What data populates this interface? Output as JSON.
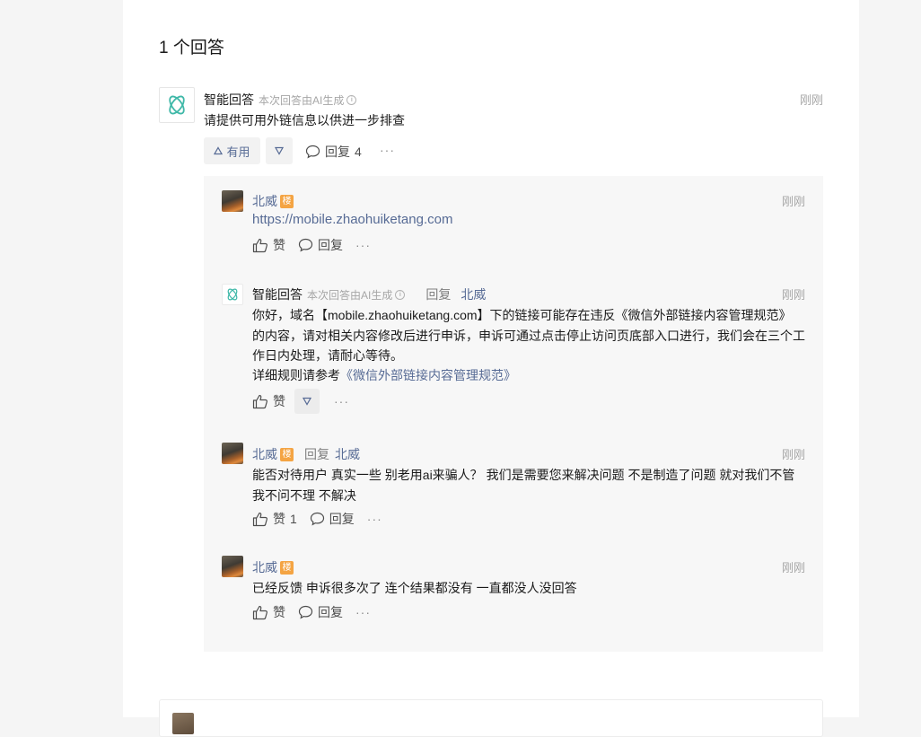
{
  "answers": {
    "count_title": "1 个回答"
  },
  "answer": {
    "author": "智能回答",
    "ai_notice": "本次回答由AI生成",
    "time": "刚刚",
    "text": "请提供可用外链信息以供进一步排查",
    "useful_label": "有用",
    "reply_label": "回复",
    "reply_count": "4",
    "more": "···"
  },
  "replies": [
    {
      "author": "北威",
      "badge": "楼",
      "time": "刚刚",
      "text": "https://mobile.zhaohuiketang.com",
      "like_label": "赞",
      "reply_label": "回复",
      "more": "···"
    },
    {
      "author": "智能回答",
      "ai_notice": "本次回答由AI生成",
      "reply_word": "回复",
      "reply_to": "北威",
      "time": "刚刚",
      "lines": [
        "你好，域名【mobile.zhaohuiketang.com】下的链接可能存在违反《微信外部链接内容管理规范》",
        "的内容，请对相关内容修改后进行申诉，申诉可通过点击停止访问页底部入口进行，我们会在三个工",
        "作日内处理，请耐心等待。"
      ],
      "detail_prefix": "详细规则请参考",
      "detail_link": "《微信外部链接内容管理规范》",
      "like_label": "赞",
      "more": "···"
    },
    {
      "author": "北威",
      "badge": "楼",
      "reply_word": "回复",
      "reply_to": "北威",
      "time": "刚刚",
      "lines": [
        "能否对待用户 真实一些 别老用ai来骗人？ 我们是需要您来解决问题 不是制造了问题 就对我们不管",
        "我不问不理 不解决"
      ],
      "like_label": "赞",
      "like_count": "1",
      "reply_label": "回复",
      "more": "···"
    },
    {
      "author": "北威",
      "badge": "楼",
      "time": "刚刚",
      "text": "已经反馈 申诉很多次了 连个结果都没有  一直都没人没回答",
      "like_label": "赞",
      "reply_label": "回复",
      "more": "···"
    }
  ],
  "colors": {
    "link": "#576b95",
    "badge": "#f4a443",
    "ai_logo": "#3fb8a8"
  },
  "icons": [
    "ai-logo-icon",
    "info-icon",
    "thumbs-up-icon",
    "thumbs-down-icon",
    "comment-icon",
    "more-icon"
  ]
}
